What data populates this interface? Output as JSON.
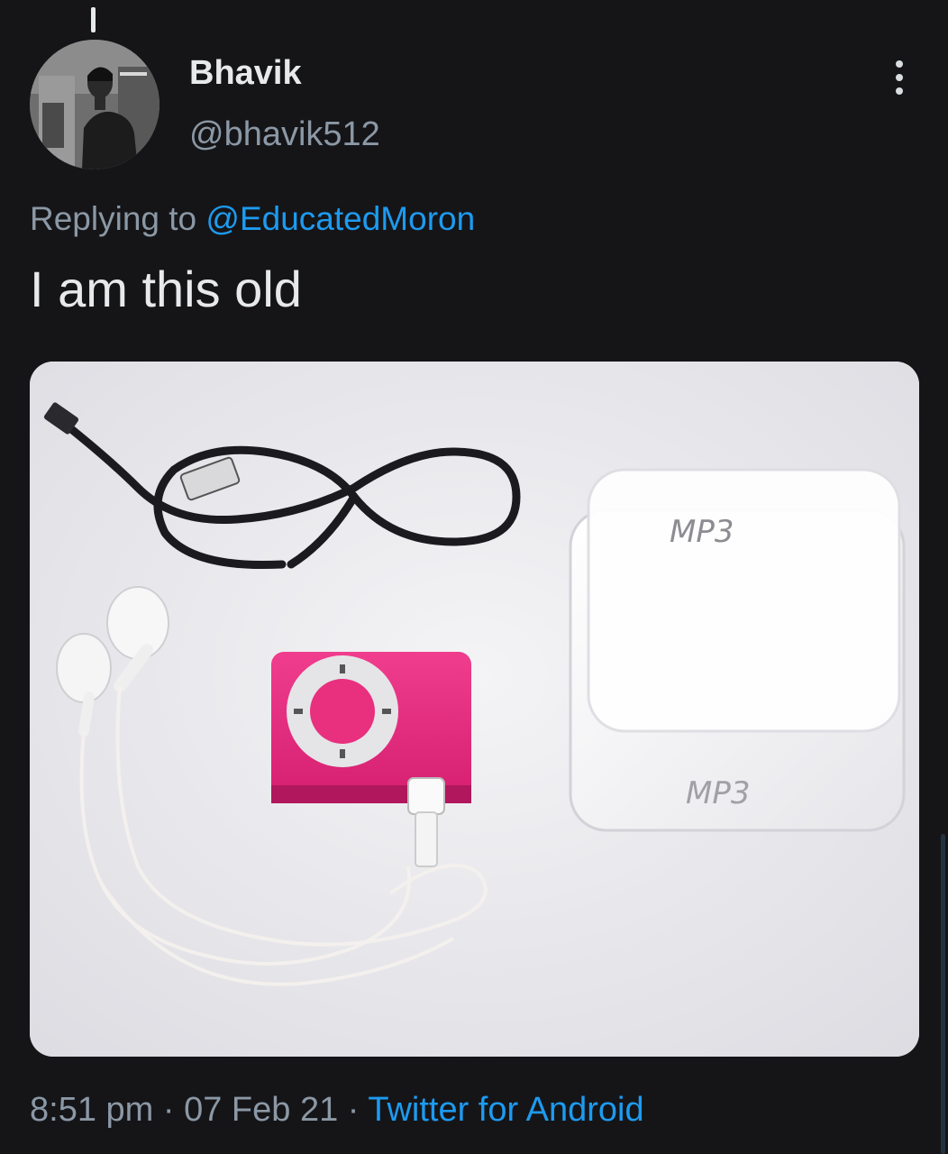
{
  "author": {
    "display_name": "Bhavik",
    "handle": "@bhavik512"
  },
  "reply": {
    "prefix": "Replying to ",
    "mention": "@EducatedMoron"
  },
  "tweet": {
    "text": "I am this old"
  },
  "media": {
    "box_label_top": "MP3",
    "box_label_side": "MP3"
  },
  "meta": {
    "time": "8:51 pm",
    "sep1": " · ",
    "date": "07 Feb 21",
    "sep2": " · ",
    "source": "Twitter for Android"
  },
  "colors": {
    "background": "#151518",
    "text_primary": "#e7e9ea",
    "text_secondary": "#8b98a5",
    "accent": "#1d9bf0"
  },
  "icons": {
    "more": "more-vertical-icon"
  }
}
